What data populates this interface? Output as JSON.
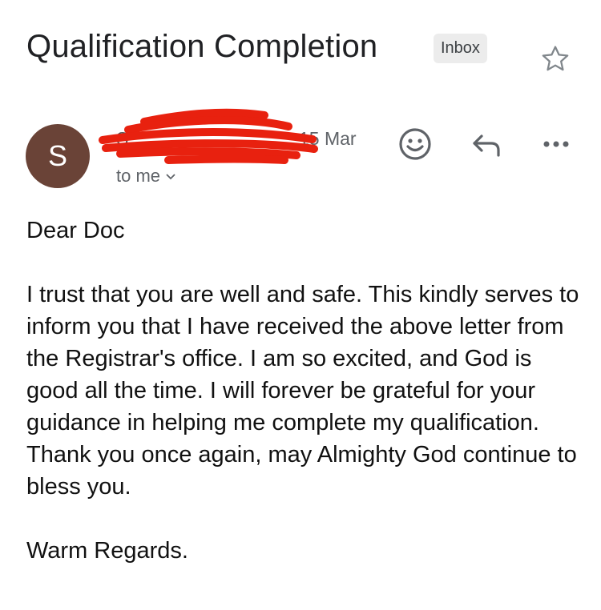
{
  "email": {
    "subject": "Qualification Completion",
    "label": "Inbox",
    "sender": {
      "initial": "S",
      "name": "S",
      "date": "15 Mar",
      "recipient": "to me"
    },
    "body": {
      "greeting": "Dear Doc",
      "paragraph": "I trust that you are well and safe. This kindly serves to inform you that I have received the above letter from the Registrar's office. I am so excited, and God is good all the time. I will forever be grateful for your guidance in helping me complete my qualification. Thank you once again, may Almighty God continue to bless you.",
      "closing": "Warm Regards."
    }
  },
  "icons": {
    "star": "star-icon",
    "emoji": "smiley-icon",
    "reply": "reply-icon",
    "more": "more-horizontal-icon",
    "expand": "chevron-down-icon"
  },
  "colors": {
    "avatar": "#6a4337",
    "redaction": "#e8210f",
    "badge_bg": "#ececec"
  }
}
